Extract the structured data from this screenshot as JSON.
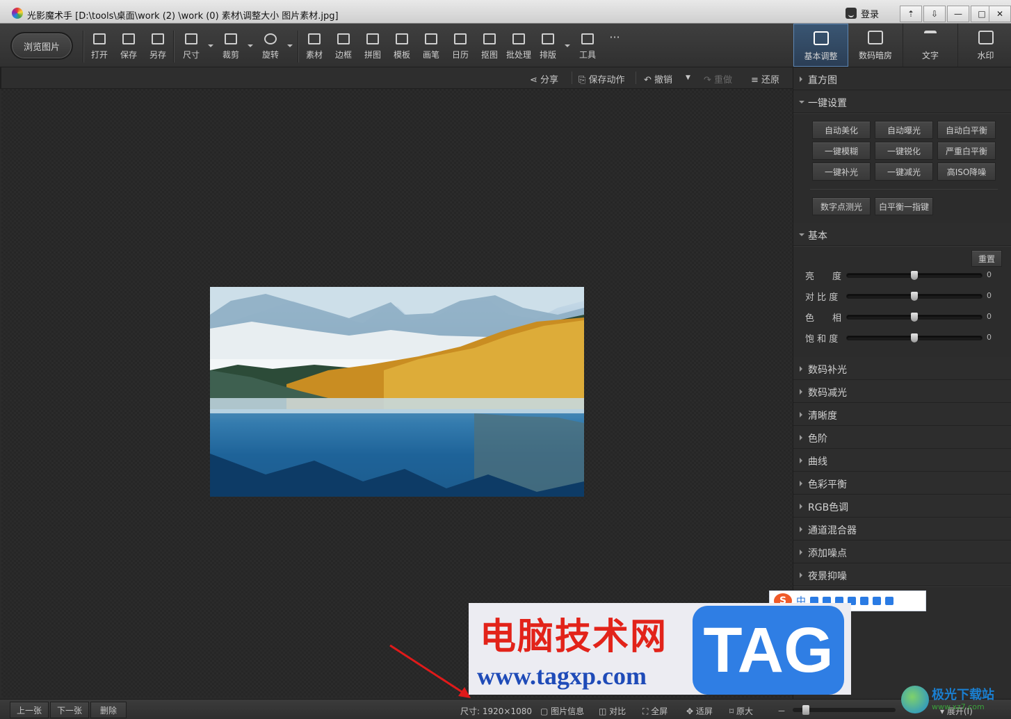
{
  "window": {
    "title": "光影魔术手  [D:\\tools\\桌面\\work (2) \\work (0) 素材\\调整大小 图片素材.jpg]",
    "login": "登录",
    "buttons": [
      "⇡",
      "⇩",
      "—",
      "□",
      "✕"
    ]
  },
  "toolbar": {
    "browse": "浏览图片",
    "items": [
      {
        "label": "打开",
        "icon": "open-icon"
      },
      {
        "label": "保存",
        "icon": "save-icon"
      },
      {
        "label": "另存",
        "icon": "save-as-icon"
      },
      {
        "label": "尺寸",
        "icon": "resize-icon"
      },
      {
        "label": "裁剪",
        "icon": "crop-icon"
      },
      {
        "label": "旋转",
        "icon": "rotate-icon"
      },
      {
        "label": "素材",
        "icon": "material-icon"
      },
      {
        "label": "边框",
        "icon": "border-icon"
      },
      {
        "label": "拼图",
        "icon": "collage-icon"
      },
      {
        "label": "模板",
        "icon": "template-icon"
      },
      {
        "label": "画笔",
        "icon": "brush-icon"
      },
      {
        "label": "日历",
        "icon": "calendar-icon"
      },
      {
        "label": "抠图",
        "icon": "cutout-icon"
      },
      {
        "label": "批处理",
        "icon": "batch-icon"
      },
      {
        "label": "排版",
        "icon": "layout-icon"
      },
      {
        "label": "工具",
        "icon": "wrench-icon"
      }
    ],
    "more": "···"
  },
  "right_tabs": [
    {
      "label": "基本调整",
      "icon": "edit-icon"
    },
    {
      "label": "数码暗房",
      "icon": "darkroom-icon"
    },
    {
      "label": "文字",
      "icon": "text-icon"
    },
    {
      "label": "水印",
      "icon": "watermark-icon"
    }
  ],
  "actions": {
    "share": "分享",
    "save_action": "保存动作",
    "undo": "撤销",
    "redo": "重做",
    "restore": "还原"
  },
  "panel": {
    "histogram": "直方图",
    "one_click": "一键设置",
    "quick_buttons": [
      "自动美化",
      "自动曝光",
      "自动白平衡",
      "一键模糊",
      "一键锐化",
      "严重白平衡",
      "一键补光",
      "一键减光",
      "高ISO降噪"
    ],
    "extra_buttons": [
      "数字点测光",
      "白平衡一指键"
    ],
    "basic": "基本",
    "reset": "重置",
    "sliders": [
      {
        "label": "亮　　度",
        "value": "0",
        "level": 0.5
      },
      {
        "label": "对 比 度",
        "value": "0",
        "level": 0.5
      },
      {
        "label": "色　　相",
        "value": "0",
        "level": 0.5
      },
      {
        "label": "饱 和 度",
        "value": "0",
        "level": 0.5
      }
    ],
    "sections": [
      "数码补光",
      "数码减光",
      "清晰度",
      "色阶",
      "曲线",
      "色彩平衡",
      "RGB色调",
      "通道混合器",
      "添加噪点",
      "夜景抑噪"
    ]
  },
  "status": {
    "prev": "上一张",
    "next": "下一张",
    "delete": "删除",
    "size": "尺寸: 1920×1080",
    "info": "图片信息",
    "compare": "对比",
    "fullscreen": "全屏",
    "fit": "适屏",
    "original": "原大",
    "zoom_minus": "－",
    "zoom_level": 0.1,
    "expand": "展开(I)"
  },
  "ime": {
    "logo": "S",
    "lang": "中"
  },
  "watermark": {
    "title": "电脑技术网",
    "url": "www.tagxp.com",
    "tag": "TAG"
  },
  "site": {
    "name": "极光下载站",
    "url": "www.xz7.com"
  }
}
